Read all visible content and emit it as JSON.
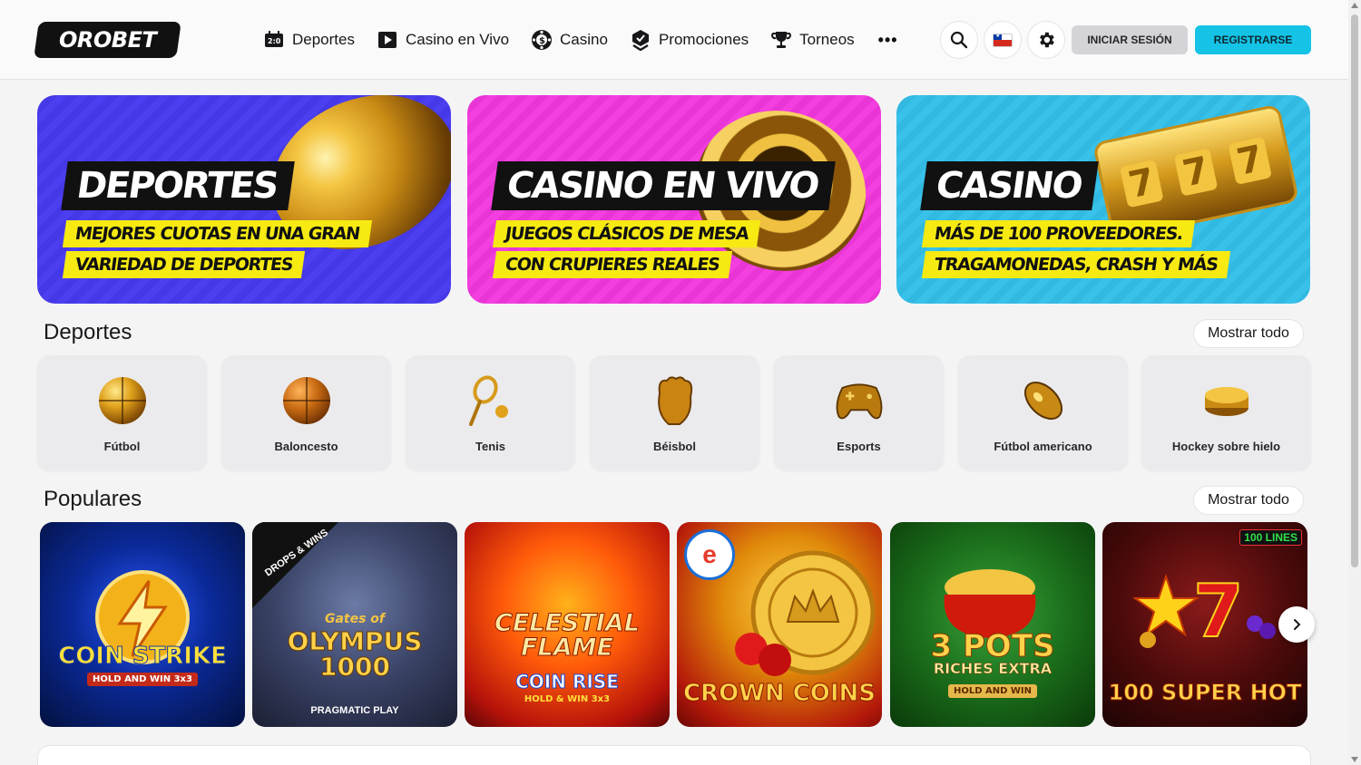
{
  "header": {
    "logo_text": "OROBET",
    "nav": [
      {
        "label": "Deportes",
        "icon": "scoreboard-icon"
      },
      {
        "label": "Casino en Vivo",
        "icon": "play-icon"
      },
      {
        "label": "Casino",
        "icon": "chip-icon"
      },
      {
        "label": "Promociones",
        "icon": "badge-icon"
      },
      {
        "label": "Torneos",
        "icon": "trophy-icon"
      }
    ],
    "more_label": "•••",
    "login_label": "INICIAR SESIÓN",
    "register_label": "REGISTRARSE",
    "colors": {
      "register": "#15c3e6",
      "login": "#d4d4d8"
    }
  },
  "banners": [
    {
      "title": "DEPORTES",
      "line1": "MEJORES CUOTAS EN UNA GRAN",
      "line2": "VARIEDAD DE DEPORTES",
      "color": "#4b3ff0"
    },
    {
      "title": "CASINO EN VIVO",
      "line1": "JUEGOS CLÁSICOS DE MESA",
      "line2": "CON CRUPIERES REALES",
      "color": "#f33fdf"
    },
    {
      "title": "CASINO",
      "line1": "MÁS DE 100 PROVEEDORES.",
      "line2": "TRAGAMONEDAS, CRASH Y MÁS",
      "color": "#38c2ea"
    }
  ],
  "sports": {
    "title": "Deportes",
    "show_all": "Mostrar todo",
    "items": [
      {
        "label": "Fútbol",
        "icon": "soccer-ball-icon"
      },
      {
        "label": "Baloncesto",
        "icon": "basketball-icon"
      },
      {
        "label": "Tenis",
        "icon": "tennis-racket-icon"
      },
      {
        "label": "Béisbol",
        "icon": "baseball-glove-icon"
      },
      {
        "label": "Esports",
        "icon": "gamepad-icon"
      },
      {
        "label": "Fútbol americano",
        "icon": "football-icon"
      },
      {
        "label": "Hockey sobre hielo",
        "icon": "hockey-puck-icon"
      }
    ]
  },
  "popular": {
    "title": "Populares",
    "show_all": "Mostrar todo",
    "games": [
      {
        "title": "COIN STRIKE",
        "sub": "HOLD AND WIN 3x3"
      },
      {
        "title": "OLYMPUS 1000",
        "pre": "Gates of",
        "badge": "DROPS & WINS",
        "provider": "PRAGMATIC PLAY"
      },
      {
        "title": "CELESTIAL FLAME",
        "sub": "COIN RISE",
        "sub2": "HOLD & WIN 3x3"
      },
      {
        "title": "CROWN COINS"
      },
      {
        "title": "3 POTS",
        "sub": "RICHES EXTRA",
        "sub2": "HOLD AND WIN"
      },
      {
        "title": "100 SUPER HOT",
        "badge": "100 LINES"
      }
    ]
  }
}
